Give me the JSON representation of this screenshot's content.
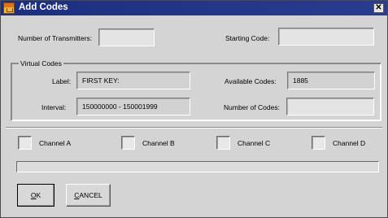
{
  "window": {
    "title": "Add Codes",
    "close_glyph": "✕",
    "title_bar_color": "#1c2e7e",
    "face_color": "#d4d4d4"
  },
  "fields": {
    "num_transmitters_label": "Number of Transmitters:",
    "num_transmitters_value": "",
    "starting_code_label": "Starting Code:",
    "starting_code_value": ""
  },
  "virtual_codes": {
    "legend": "Virtual Codes",
    "label_label": "Label:",
    "label_value": "FIRST KEY:",
    "available_label": "Available Codes:",
    "available_value": "1885",
    "interval_label": "Interval:",
    "interval_value": "150000000 - 150001999",
    "num_codes_label": "Number of Codes:",
    "num_codes_value": ""
  },
  "channels": [
    {
      "label": "Channel A",
      "checked": false
    },
    {
      "label": "Channel B",
      "checked": false
    },
    {
      "label": "Channel C",
      "checked": false
    },
    {
      "label": "Channel D",
      "checked": false
    }
  ],
  "progress": {
    "fraction": 0
  },
  "buttons": {
    "ok_mnemonic": "O",
    "ok_rest": "K",
    "cancel_mnemonic": "C",
    "cancel_rest": "ANCEL"
  }
}
